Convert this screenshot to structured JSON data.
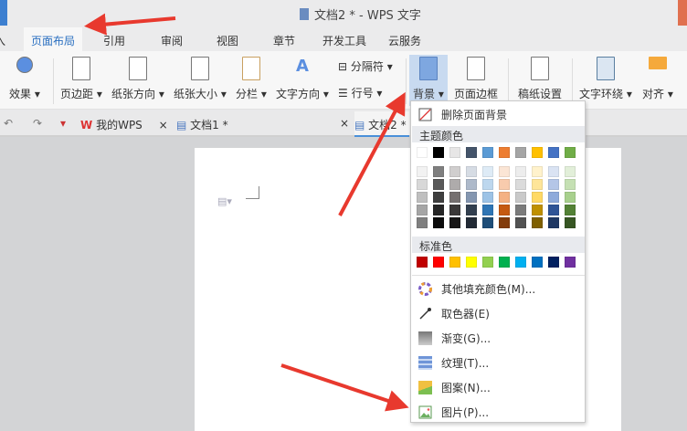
{
  "window": {
    "title": "文档2 * - WPS 文字"
  },
  "tabs": [
    {
      "label": "入"
    },
    {
      "label": "页面布局",
      "active": true
    },
    {
      "label": "引用"
    },
    {
      "label": "审阅"
    },
    {
      "label": "视图"
    },
    {
      "label": "章节"
    },
    {
      "label": "开发工具"
    },
    {
      "label": "云服务"
    }
  ],
  "ribbon": {
    "effects": "效果",
    "margins": "页边距",
    "orientation": "纸张方向",
    "size": "纸张大小",
    "columns": "分栏",
    "text_direction": "文字方向",
    "breaks": "分隔符",
    "line_numbers": "行号",
    "background": "背景",
    "page_border": "页面边框",
    "manuscript": "稿纸设置",
    "wrap_text": "文字环绕",
    "align": "对齐"
  },
  "doc_tabs": [
    {
      "label": "我的WPS"
    },
    {
      "label": "文档1 *"
    },
    {
      "label": "文档2 *"
    }
  ],
  "menu": {
    "remove_bg": "删除页面背景",
    "theme_colors_label": "主题颜色",
    "theme_colors": [
      "#ffffff",
      "#000000",
      "#e7e6e6",
      "#44546a",
      "#5b9bd5",
      "#ed7d31",
      "#a5a5a5",
      "#ffc000",
      "#4472c4",
      "#70ad47"
    ],
    "theme_shades": [
      [
        "#f2f2f2",
        "#7f7f7f",
        "#d0cece",
        "#d6dce4",
        "#deebf6",
        "#fbe5d5",
        "#ededed",
        "#fff2cc",
        "#dae3f3",
        "#e2efd9"
      ],
      [
        "#d8d8d8",
        "#595959",
        "#aeabab",
        "#adb9ca",
        "#bdd7ee",
        "#f8cbad",
        "#dbdbdb",
        "#fee599",
        "#b4c6e7",
        "#c5e0b3"
      ],
      [
        "#bfbfbf",
        "#3f3f3f",
        "#757070",
        "#8496b0",
        "#9dc3e6",
        "#f4b183",
        "#c9c9c9",
        "#ffd965",
        "#8eaadb",
        "#a8d08d"
      ],
      [
        "#a5a5a5",
        "#262626",
        "#3a3838",
        "#323f4f",
        "#2e75b5",
        "#c55a11",
        "#7b7b7b",
        "#bf9000",
        "#2f5496",
        "#538135"
      ],
      [
        "#7f7f7f",
        "#0c0c0c",
        "#171616",
        "#222a35",
        "#1e4e79",
        "#833c0b",
        "#525252",
        "#7f6000",
        "#1f3864",
        "#375623"
      ]
    ],
    "standard_colors_label": "标准色",
    "standard_colors": [
      "#c00000",
      "#ff0000",
      "#ffc000",
      "#ffff00",
      "#92d050",
      "#00b050",
      "#00b0f0",
      "#0070c0",
      "#002060",
      "#7030a0"
    ],
    "items": [
      {
        "label": "其他填充颜色(M)...",
        "icon": "color-wheel-icon"
      },
      {
        "label": "取色器(E)",
        "icon": "eyedropper-icon"
      },
      {
        "label": "渐变(G)...",
        "icon": "gradient-icon"
      },
      {
        "label": "纹理(T)...",
        "icon": "texture-icon"
      },
      {
        "label": "图案(N)...",
        "icon": "pattern-icon"
      },
      {
        "label": "图片(P)...",
        "icon": "picture-icon"
      }
    ]
  },
  "annotation_color": "#e8392e"
}
